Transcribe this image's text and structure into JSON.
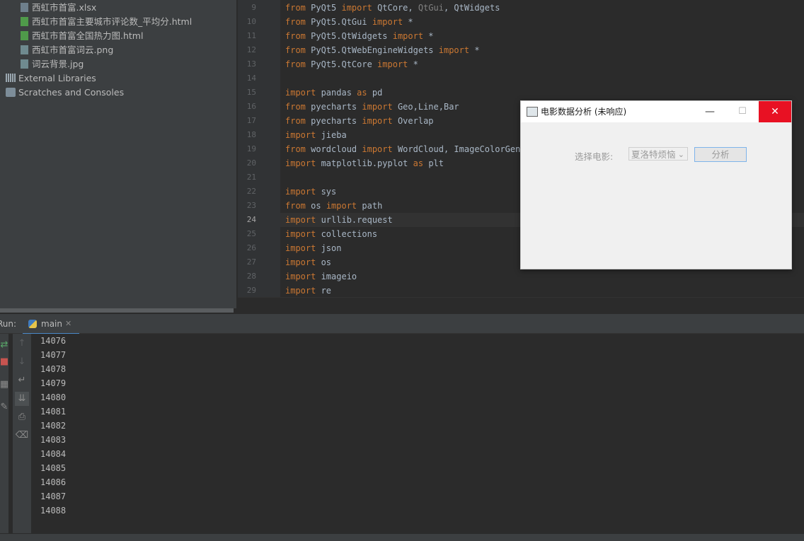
{
  "project_tree": {
    "files": [
      {
        "name": "西虹市首富.xlsx",
        "type": "xlsx"
      },
      {
        "name": "西虹市首富主要城市评论数_平均分.html",
        "type": "html"
      },
      {
        "name": "西虹市首富全国热力图.html",
        "type": "html"
      },
      {
        "name": "西虹市首富词云.png",
        "type": "img"
      },
      {
        "name": "词云背景.jpg",
        "type": "img"
      }
    ],
    "external_libraries": "External Libraries",
    "scratches": "Scratches and Consoles"
  },
  "editor": {
    "current_line": "24",
    "lines": [
      {
        "num": "9",
        "parts": [
          [
            "kw",
            "from "
          ],
          [
            "",
            "PyQt5 "
          ],
          [
            "kw",
            "import "
          ],
          [
            "",
            "QtCore, "
          ],
          [
            "dim",
            "QtGui"
          ],
          [
            "",
            ", QtWidgets"
          ]
        ]
      },
      {
        "num": "10",
        "parts": [
          [
            "kw",
            "from "
          ],
          [
            "",
            "PyQt5.QtGui "
          ],
          [
            "kw",
            "import "
          ],
          [
            "",
            "*"
          ]
        ]
      },
      {
        "num": "11",
        "parts": [
          [
            "kw",
            "from "
          ],
          [
            "",
            "PyQt5.QtWidgets "
          ],
          [
            "kw",
            "import "
          ],
          [
            "",
            "*"
          ]
        ]
      },
      {
        "num": "12",
        "parts": [
          [
            "kw",
            "from "
          ],
          [
            "",
            "PyQt5.QtWebEngineWidgets "
          ],
          [
            "kw",
            "import "
          ],
          [
            "",
            "*"
          ]
        ]
      },
      {
        "num": "13",
        "parts": [
          [
            "kw",
            "from "
          ],
          [
            "",
            "PyQt5.QtCore "
          ],
          [
            "kw",
            "import "
          ],
          [
            "",
            "*"
          ]
        ]
      },
      {
        "num": "14",
        "parts": []
      },
      {
        "num": "15",
        "parts": [
          [
            "kw",
            "import "
          ],
          [
            "",
            "pandas "
          ],
          [
            "kw",
            "as "
          ],
          [
            "",
            "pd"
          ]
        ]
      },
      {
        "num": "16",
        "parts": [
          [
            "kw",
            "from "
          ],
          [
            "",
            "pyecharts "
          ],
          [
            "kw",
            "import "
          ],
          [
            "",
            "Geo,Line,Bar"
          ]
        ]
      },
      {
        "num": "17",
        "parts": [
          [
            "kw",
            "from "
          ],
          [
            "",
            "pyecharts "
          ],
          [
            "kw",
            "import "
          ],
          [
            "",
            "Overlap"
          ]
        ]
      },
      {
        "num": "18",
        "parts": [
          [
            "kw",
            "import "
          ],
          [
            "",
            "jieba"
          ]
        ]
      },
      {
        "num": "19",
        "parts": [
          [
            "kw",
            "from "
          ],
          [
            "",
            "wordcloud "
          ],
          [
            "kw",
            "import "
          ],
          [
            "",
            "WordCloud, ImageColorGener"
          ]
        ]
      },
      {
        "num": "20",
        "parts": [
          [
            "kw",
            "import "
          ],
          [
            "",
            "matplotlib.pyplot "
          ],
          [
            "kw",
            "as "
          ],
          [
            "",
            "plt"
          ]
        ]
      },
      {
        "num": "21",
        "parts": []
      },
      {
        "num": "22",
        "parts": [
          [
            "kw",
            "import "
          ],
          [
            "",
            "sys"
          ]
        ]
      },
      {
        "num": "23",
        "parts": [
          [
            "kw",
            "from "
          ],
          [
            "",
            "os "
          ],
          [
            "kw",
            "import "
          ],
          [
            "",
            "path"
          ]
        ]
      },
      {
        "num": "24",
        "parts": [
          [
            "kw",
            "import "
          ],
          [
            "",
            "urllib.request"
          ]
        ]
      },
      {
        "num": "25",
        "parts": [
          [
            "kw",
            "import "
          ],
          [
            "",
            "collections"
          ]
        ]
      },
      {
        "num": "26",
        "parts": [
          [
            "kw",
            "import "
          ],
          [
            "",
            "json"
          ]
        ]
      },
      {
        "num": "27",
        "parts": [
          [
            "kw",
            "import "
          ],
          [
            "",
            "os"
          ]
        ]
      },
      {
        "num": "28",
        "parts": [
          [
            "kw",
            "import "
          ],
          [
            "",
            "imageio"
          ]
        ]
      },
      {
        "num": "29",
        "parts": [
          [
            "kw",
            "import "
          ],
          [
            "",
            "re"
          ]
        ]
      }
    ]
  },
  "run_panel": {
    "label": "Run:",
    "tab": "main",
    "output": [
      "14076",
      "14077",
      "14078",
      "14079",
      "14080",
      "14081",
      "14082",
      "14083",
      "14084",
      "14085",
      "14086",
      "14087",
      "14088"
    ]
  },
  "dialog": {
    "title": "电影数据分析 (未响应)",
    "minimize": "—",
    "maximize": "☐",
    "close": "✕",
    "label": "选择电影:",
    "selected_movie": "夏洛特烦恼",
    "analyze_button": "分析",
    "close_color": "#e81123"
  }
}
